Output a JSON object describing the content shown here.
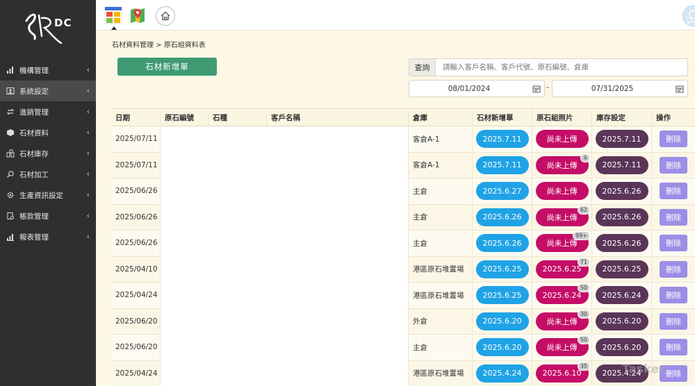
{
  "logo": {
    "text": "DC"
  },
  "sidebar": {
    "items": [
      {
        "label": "機構管理",
        "icon": "bar-chart-icon",
        "active": false
      },
      {
        "label": "系統設定",
        "icon": "user-card-icon",
        "active": true
      },
      {
        "label": "進銷管理",
        "icon": "exchange-icon",
        "active": false
      },
      {
        "label": "石材資料",
        "icon": "cube-icon",
        "active": false
      },
      {
        "label": "石材庫存",
        "icon": "warehouse-icon",
        "active": false
      },
      {
        "label": "石材加工",
        "icon": "search-icon",
        "active": false
      },
      {
        "label": "生產資訊設定",
        "icon": "gear-icon",
        "active": false
      },
      {
        "label": "帳款管理",
        "icon": "ledger-icon",
        "active": false
      },
      {
        "label": "報表管理",
        "icon": "report-icon",
        "active": false
      }
    ],
    "arrow": "‹"
  },
  "breadcrumb": "石材資料管理 > 原石組資料表",
  "add_button": "石材新增單",
  "search": {
    "label": "查詢",
    "placeholder": "請輸入客戶名稱、客戶代號、原石編號、倉庫"
  },
  "date_range": {
    "start": "08/01/2024",
    "end": "07/31/2025",
    "separator": "-"
  },
  "table": {
    "headers": {
      "date": "日期",
      "code": "原石編號",
      "stone": "石種",
      "customer": "客戶名稱",
      "warehouse": "倉庫",
      "add": "石材新增單",
      "photo": "原石組照片",
      "stock": "庫存設定",
      "op": "操作"
    },
    "rows": [
      {
        "date": "2025/07/11",
        "warehouse": "客倉A-1",
        "add": "2025.7.11",
        "photo": "尚未上傳",
        "badge": "",
        "stock": "2025.7.11",
        "op": "刪除"
      },
      {
        "date": "2025/07/11",
        "warehouse": "客倉A-1",
        "add": "2025.7.11",
        "photo": "尚未上傳",
        "badge": "4",
        "stock": "2025.7.11",
        "op": "刪除"
      },
      {
        "date": "2025/06/26",
        "warehouse": "主倉",
        "add": "2025.6.27",
        "photo": "尚未上傳",
        "badge": "",
        "stock": "2025.6.26",
        "op": "刪除"
      },
      {
        "date": "2025/06/26",
        "warehouse": "主倉",
        "add": "2025.6.26",
        "photo": "尚未上傳",
        "badge": "62",
        "stock": "2025.6.26",
        "op": "刪除"
      },
      {
        "date": "2025/06/26",
        "warehouse": "主倉",
        "add": "2025.6.26",
        "photo": "尚未上傳",
        "badge": "99+",
        "stock": "2025.6.26",
        "op": "刪除"
      },
      {
        "date": "2025/04/10",
        "warehouse": "港區原石堆置場",
        "add": "2025.6.25",
        "photo": "2025.6.25",
        "badge": "71",
        "stock": "2025.6.25",
        "op": "刪除"
      },
      {
        "date": "2025/04/24",
        "warehouse": "港區原石堆置場",
        "add": "2025.6.25",
        "photo": "2025.6.24",
        "badge": "50",
        "stock": "2025.6.24",
        "op": "刪除"
      },
      {
        "date": "2025/06/20",
        "warehouse": "外倉",
        "add": "2025.6.20",
        "photo": "尚未上傳",
        "badge": "30",
        "stock": "2025.6.20",
        "op": "刪除"
      },
      {
        "date": "2025/06/20",
        "warehouse": "主倉",
        "add": "2025.6.20",
        "photo": "尚未上傳",
        "badge": "50",
        "stock": "2025.6.20",
        "op": "刪除"
      },
      {
        "date": "2025/04/24",
        "warehouse": "港區原石堆置場",
        "add": "2025.4.24",
        "photo": "2025.6.10",
        "badge": "35",
        "stock": "2025.4.24",
        "op": "刪除"
      }
    ]
  },
  "colors": {
    "sidebar": "#2f2f2f",
    "add_button": "#3f9b74",
    "pill_blue": "#1fa3e6",
    "pill_pink": "#c50d67",
    "pill_purple": "#5a3558",
    "delete": "#9c8ee6"
  },
  "watermark": "Tasker"
}
